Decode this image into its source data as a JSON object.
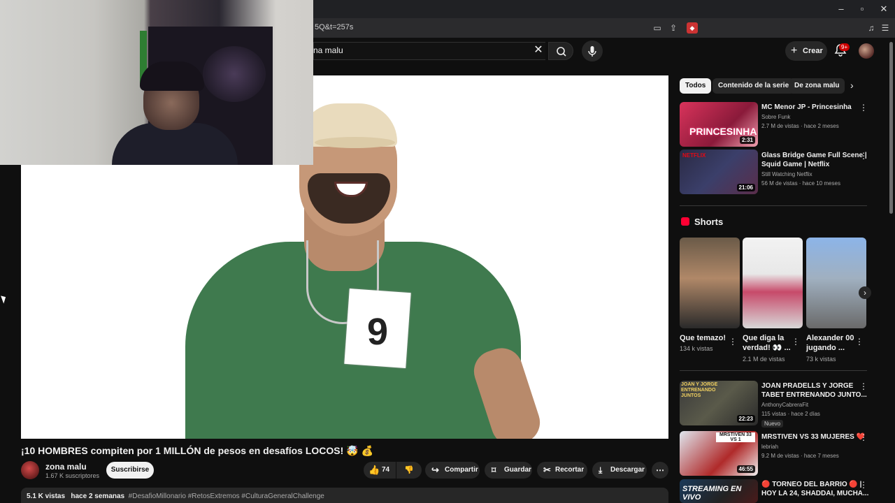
{
  "browser": {
    "url": "5Q&t=257s",
    "window_controls": [
      "–",
      "▫",
      "✕"
    ]
  },
  "header": {
    "search_value": "na malu",
    "create_label": "Crear",
    "notif_count": "9+"
  },
  "video": {
    "tag_number": "9",
    "title": "¡10 HOMBRES compiten por 1 MILLÓN de pesos en desafíos LOCOS! 🤯 💰",
    "channel": "zona malu",
    "subscribers": "1.67 K suscriptores",
    "subscribe_label": "Suscribirse",
    "likes": "74",
    "share_label": "Compartir",
    "save_label": "Guardar",
    "clip_label": "Recortar",
    "download_label": "Descargar",
    "views": "5.1 K vistas",
    "date": "hace 2 semanas",
    "hashtags": "#DesafioMillonario #RetosExtremos #CulturaGeneralChallenge"
  },
  "chips": [
    "Todos",
    "Contenido de la serie",
    "De zona malu"
  ],
  "recommendations_top": [
    {
      "title": "MC Menor JP - Princesinha",
      "channel": "Sobre Funk",
      "meta": "2.7 M de vistas · hace 2 meses",
      "duration": "2:31",
      "thumb_text": "PRINCESINHA"
    },
    {
      "title_line1": "Glass Bridge Game Full Scene |",
      "title_line2": "Squid Game | Netflix",
      "channel": "Still Watching Netflix",
      "meta": "56 M de vistas · hace 10 meses",
      "duration": "21:06",
      "thumb_text": "NETFLIX"
    }
  ],
  "shorts": {
    "heading": "Shorts",
    "items": [
      {
        "title": "Que temazo!",
        "views": "134 k vistas"
      },
      {
        "title_line1": "Que diga la",
        "title_line2": "verdad! 👀 ...",
        "views": "2.1 M de vistas"
      },
      {
        "title_line1": "Alexander 00",
        "title_line2": "jugando ...",
        "views": "73 k vistas"
      }
    ]
  },
  "recommendations_bottom": [
    {
      "title_line1": "JOAN PRADELLS Y JORGE",
      "title_line2": "TABET ENTRENANDO JUNTO...",
      "channel": "AnthonyCabreraFit",
      "meta": "115 vistas · hace 2 días",
      "badge": "Nuevo",
      "duration": "22:23",
      "thumb_text": "JOAN Y JORGE ENTRENANDO JUNTOS"
    },
    {
      "title": "MRSTIVEN VS 33 MUJERES ❤️",
      "channel": "lebriah",
      "meta": "9.2 M de vistas · hace 7 meses",
      "duration": "46:55",
      "thumb_text": "MRSTIVEN 33 VS 1"
    },
    {
      "title_line1": "🔴 TORNEO DEL BARRIO 🔴 |",
      "title_line2": "HOY LA 24, SHADDAI, MUCHA...",
      "thumb_text": "STREAMING EN VIVO"
    }
  ],
  "colors": {
    "accent_red": "#ff0033",
    "bg": "#0f0f0f",
    "chip_bg": "#272727"
  }
}
